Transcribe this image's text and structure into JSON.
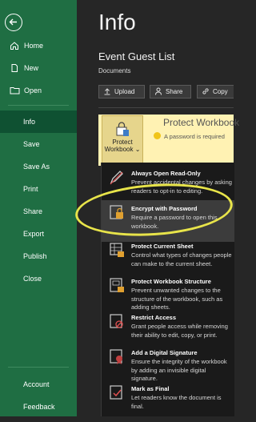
{
  "sidebar": {
    "items": [
      {
        "label": "Home",
        "icon": "home-icon"
      },
      {
        "label": "New",
        "icon": "new-file-icon"
      },
      {
        "label": "Open",
        "icon": "folder-icon"
      },
      {
        "label": "Info",
        "selected": true
      },
      {
        "label": "Save"
      },
      {
        "label": "Save As"
      },
      {
        "label": "Print"
      },
      {
        "label": "Share"
      },
      {
        "label": "Export"
      },
      {
        "label": "Publish"
      },
      {
        "label": "Close"
      }
    ],
    "bottom": [
      {
        "label": "Account"
      },
      {
        "label": "Feedback"
      }
    ]
  },
  "main": {
    "title": "Info",
    "file_name": "Event Guest List",
    "file_location": "Documents",
    "actions": [
      {
        "label": "Upload",
        "icon": "upload-icon"
      },
      {
        "label": "Share",
        "icon": "share-icon"
      },
      {
        "label": "Copy",
        "icon": "copy-link-icon"
      }
    ]
  },
  "protect": {
    "button_label_line1": "Protect",
    "button_label_line2": "Workbook",
    "heading": "Protect Workbook",
    "description": "A password is required"
  },
  "dropdown": {
    "items": [
      {
        "title": "Always Open Read-Only",
        "desc": "Prevent accidental changes by asking readers to opt-in to editing.",
        "icon": "pencil-icon"
      },
      {
        "title": "Encrypt with Password",
        "desc": "Require a password to open this workbook.",
        "icon": "lock-icon",
        "highlighted": true
      },
      {
        "title": "Protect Current Sheet",
        "desc": "Control what types of changes people can make to the current sheet.",
        "icon": "sheet-lock-icon"
      },
      {
        "title": "Protect Workbook Structure",
        "desc": "Prevent unwanted changes to the structure of the workbook, such as adding sheets.",
        "icon": "workbook-lock-icon"
      },
      {
        "title": "Restrict Access",
        "desc": "Grant people access while removing their ability to edit, copy, or print.",
        "icon": "restrict-access-icon"
      },
      {
        "title": "Add a Digital Signature",
        "desc": "Ensure the integrity of the workbook by adding an invisible digital signature.",
        "icon": "signature-icon"
      },
      {
        "title": "Mark as Final",
        "desc": "Let readers know the document is final.",
        "icon": "final-mark-icon"
      }
    ]
  },
  "colors": {
    "sidebar_bg": "#1f6e43",
    "sidebar_selected": "#0f5132",
    "main_bg": "#262626",
    "protect_bg": "#fff2b3",
    "annotation": "#e8e44a"
  }
}
